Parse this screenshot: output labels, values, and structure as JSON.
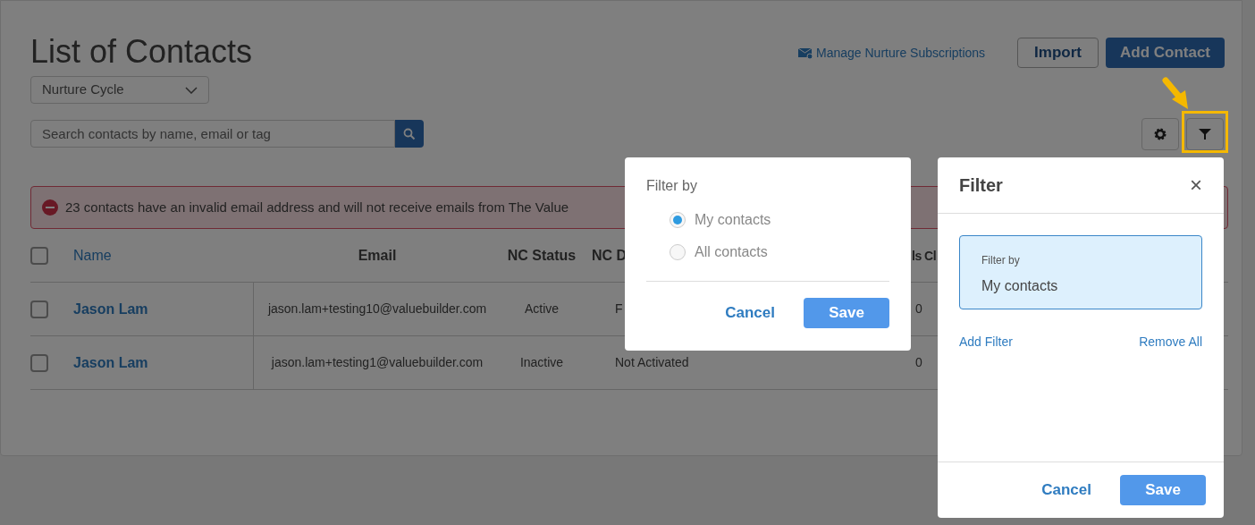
{
  "page": {
    "title": "List of Contacts",
    "dropdown": {
      "value": "Nurture Cycle"
    },
    "search": {
      "placeholder": "Search contacts by name, email or tag"
    },
    "manage_link": "Manage Nurture Subscriptions",
    "buttons": [
      {
        "label": "Import",
        "kind": "outline"
      },
      {
        "label": "Add Contact",
        "kind": "primary"
      }
    ]
  },
  "alert": "23 contacts have an invalid email address and will not receive emails from The Value",
  "table": {
    "all_checked": false,
    "columns": [
      "Name",
      "Email",
      "NC Status",
      "NC D",
      "ls Cl"
    ],
    "rows": [
      {
        "checked": false,
        "name": "Jason Lam",
        "email": "jason.lam+testing10@valuebuilder.com",
        "nc_status": "Active",
        "column_4": "F",
        "column_6": "0"
      },
      {
        "checked": false,
        "name": "Jason Lam",
        "email": "jason.lam+testing1@valuebuilder.com",
        "nc_status": "Inactive",
        "column_4": "Not Activated",
        "column_6": "0"
      }
    ]
  },
  "filter_dialog": {
    "title": "Filter by",
    "options": [
      {
        "label": "My contacts",
        "selected": true
      },
      {
        "label": "All contacts",
        "selected": false
      }
    ],
    "buttons": [
      "Cancel",
      "Save"
    ]
  },
  "filter_panel": {
    "title": "Filter",
    "close": "×",
    "card": {
      "label": "Filter by",
      "value": "My contacts"
    },
    "links": [
      "Add Filter",
      "Remove All"
    ],
    "buttons": [
      "Cancel",
      "Save"
    ]
  }
}
